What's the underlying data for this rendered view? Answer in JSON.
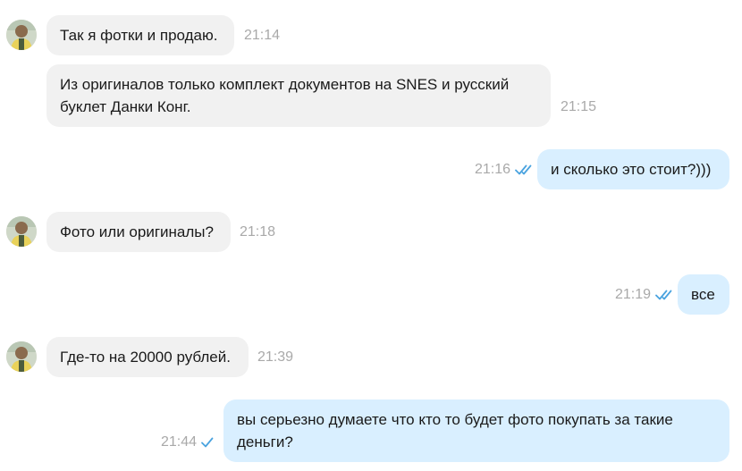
{
  "messages": [
    {
      "direction": "in",
      "text": "Так я фотки и продаю.",
      "time": "21:14"
    },
    {
      "direction": "in",
      "text_lines": [
        "Из оригиналов только комплект документов на SNES и русский",
        "буклет Данки Конг."
      ],
      "time": "21:15"
    },
    {
      "direction": "out",
      "text": "и сколько это стоит?)))",
      "time": "21:16",
      "status": "read"
    },
    {
      "direction": "in",
      "text": "Фото или оригиналы?",
      "time": "21:18"
    },
    {
      "direction": "out",
      "text": "все",
      "time": "21:19",
      "status": "read"
    },
    {
      "direction": "in",
      "text": "Где-то на 20000 рублей.",
      "time": "21:39"
    },
    {
      "direction": "out",
      "text_lines": [
        "вы серьезно думаете что кто то будет фото покупать за такие",
        "деньги?"
      ],
      "time": "21:44",
      "status": "sent"
    }
  ],
  "colors": {
    "incoming_bubble": "#f1f1f1",
    "outgoing_bubble": "#d9efff",
    "time_text": "#a9a9a9",
    "check_icon": "#4aa3df"
  },
  "icons": {
    "read": "double-check-icon",
    "sent": "single-check-icon",
    "avatar": "contact-avatar"
  }
}
